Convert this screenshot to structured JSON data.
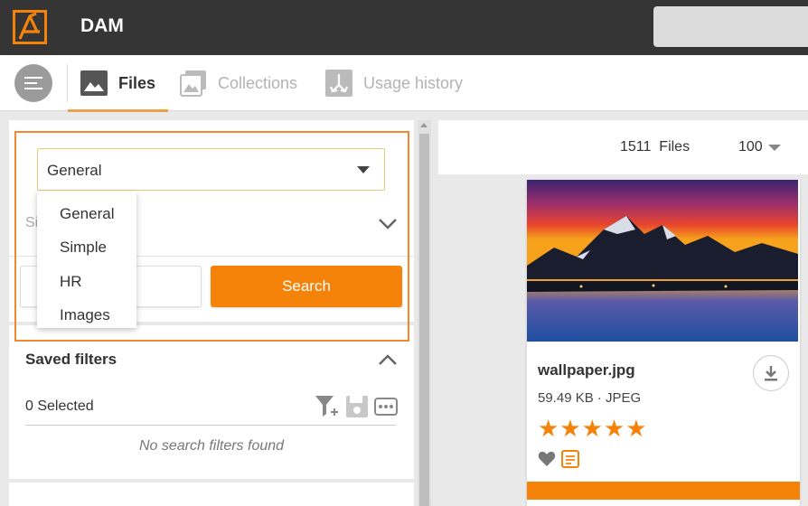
{
  "app": {
    "title": "DAM"
  },
  "nav": {
    "tabs": [
      {
        "label": "Files",
        "icon": "image-icon",
        "active": true
      },
      {
        "label": "Collections",
        "icon": "collections-icon",
        "active": false
      },
      {
        "label": "Usage history",
        "icon": "usage-history-icon",
        "active": false
      }
    ]
  },
  "search_panel": {
    "form_select": {
      "value": "General"
    },
    "dropdown_options": [
      "General",
      "Simple",
      "HR",
      "Images"
    ],
    "collapsed_section_label": "Si",
    "search_button": "Search"
  },
  "saved_filters": {
    "title": "Saved filters",
    "selected_text": "0 Selected",
    "empty_text": "No search filters found"
  },
  "results": {
    "count": "1511",
    "count_label": "Files",
    "page_size": "100"
  },
  "file_card": {
    "name": "wallpaper.jpg",
    "meta": "59.49 KB · JPEG",
    "rating": 5,
    "stars": "★★★★★"
  },
  "colors": {
    "accent": "#f5830a",
    "topbar": "#353535",
    "highlight": "#f08a2e"
  }
}
